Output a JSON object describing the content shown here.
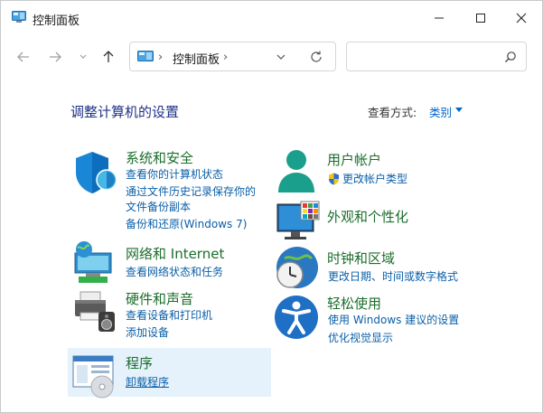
{
  "window": {
    "title": "控制面板",
    "buttons": {
      "minimize": "minimize-icon",
      "maximize": "maximize-icon",
      "close": "close-icon"
    }
  },
  "nav": {
    "back": "arrow-left-icon",
    "forward": "arrow-right-icon",
    "recent": "chevron-down-icon",
    "up": "arrow-up-icon",
    "breadcrumb": [
      "控制面板"
    ],
    "search_placeholder": ""
  },
  "header": {
    "title": "调整计算机的设置",
    "view_by_label": "查看方式:",
    "view_by_value": "类别"
  },
  "categories": [
    {
      "title": "系统和安全",
      "icon": "shield-icon",
      "links": [
        "查看你的计算机状态",
        "通过文件历史记录保存你的",
        "文件备份副本",
        "备份和还原(Windows 7)"
      ]
    },
    {
      "title": "网络和 Internet",
      "icon": "network-globe-icon",
      "links": [
        "查看网络状态和任务"
      ]
    },
    {
      "title": "硬件和声音",
      "icon": "printer-speaker-icon",
      "links": [
        "查看设备和打印机",
        "添加设备"
      ]
    },
    {
      "title": "程序",
      "icon": "programs-disc-icon",
      "links": [
        "卸载程序"
      ]
    },
    {
      "title": "用户帐户",
      "icon": "user-icon",
      "links": [
        "更改帐户类型"
      ]
    },
    {
      "title": "外观和个性化",
      "icon": "monitor-palette-icon",
      "links": []
    },
    {
      "title": "时钟和区域",
      "icon": "clock-globe-icon",
      "links": [
        "更改日期、时间或数字格式"
      ]
    },
    {
      "title": "轻松使用",
      "icon": "accessibility-icon",
      "links": [
        "使用 Windows 建议的设置",
        "优化视觉显示"
      ]
    }
  ]
}
